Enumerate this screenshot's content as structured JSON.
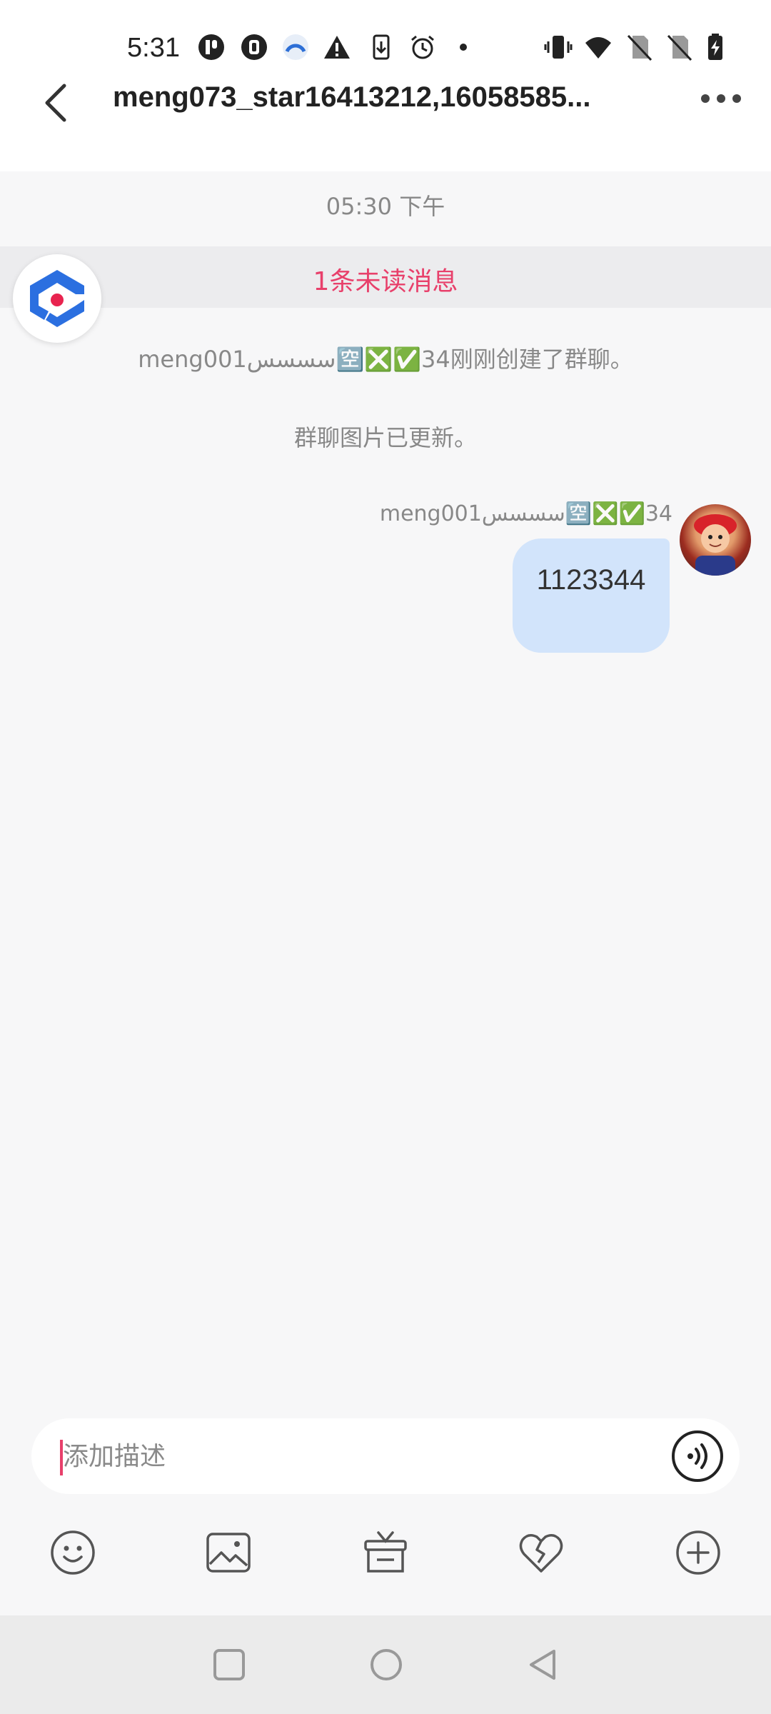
{
  "status_bar": {
    "time": "5:31",
    "icons": [
      "app-p-icon",
      "app-shield-icon",
      "app-circle-icon",
      "warning-icon",
      "download-icon",
      "alarm-icon",
      "dot-icon",
      "vibrate-icon",
      "wifi-icon",
      "no-sim-icon",
      "no-sim-2-icon",
      "battery-charging-icon"
    ]
  },
  "header": {
    "title": "meng073_star16413212,16058585..."
  },
  "chat": {
    "timestamp": "05:30 下午",
    "unread_banner": "1条未读消息",
    "system_messages": [
      "meng001سسسس🈳❎✅34刚刚创建了群聊。",
      "群聊图片已更新。"
    ],
    "message": {
      "sender": "meng001سسسس🈳❎✅34",
      "text": "1123344"
    }
  },
  "input": {
    "placeholder": "添加描述",
    "value": ""
  },
  "toolbar": {
    "items": [
      "emoji-icon",
      "image-icon",
      "gift-icon",
      "heart-broken-icon",
      "plus-icon"
    ]
  },
  "nav_bar": {
    "items": [
      "recent-apps-icon",
      "home-icon",
      "back-icon"
    ]
  },
  "colors": {
    "accent": "#e8406b",
    "bubble": "#d2e4fb",
    "background": "#f7f7f8"
  }
}
